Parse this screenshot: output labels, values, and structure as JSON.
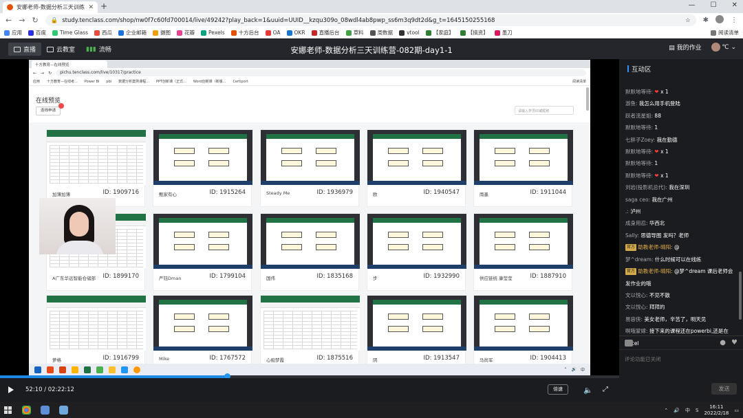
{
  "browser": {
    "tab_title": "安娜老师-数据分析三天训练营-0",
    "url": "study.tenclass.com/shop/nw0f7c60fd700014/live/49242?play_back=1&uuid=UUID__kzqu309o_08wdl4ab8pwp_ss6m3q9dt2d&g_t=1645150255168",
    "bookmarks": [
      "应用",
      "百度",
      "Time Glass",
      "西瓜",
      "企业邮箱",
      "摄图",
      "花瓣",
      "Pexels",
      "十方后台",
      "OA",
      "OKR",
      "直播后台",
      "草料",
      "周数据",
      "vtool",
      "【家庭】",
      "【搞资】",
      "墨刀"
    ],
    "reading_list": "阅读清单"
  },
  "header": {
    "tab_live": "直播",
    "tab_classroom": "云教室",
    "tab_traffic": "流畅",
    "title": "安娜老师-数据分析三天训练营-082期-day1-1",
    "homework": "我的作业",
    "user": "℃"
  },
  "inner": {
    "tab_title": "十方教育—在线预览",
    "url": "pichu.tenclass.com/live/10317/practice",
    "bookmarks": [
      "应用",
      "十方教育—在线考...",
      "Power BI",
      "pbi",
      "数据分析案例课程...",
      "PPT创新课（正式...",
      "Word创新课（新版...",
      "Certiport"
    ],
    "reading_list": "阅读清单",
    "panel_title": "在线预览",
    "panel_button": "连线申请",
    "search_placeholder": "请输入学员ID或昵称",
    "cards": [
      {
        "name": "加薄加薄",
        "id": "ID: 1909716"
      },
      {
        "name": "甄家有心",
        "id": "ID: 1915264"
      },
      {
        "name": "Steady Me",
        "id": "ID: 1936979"
      },
      {
        "name": "欧",
        "id": "ID: 1940547"
      },
      {
        "name": "雨墨",
        "id": "ID: 1911044"
      },
      {
        "name": "A广东华远智能仓储部",
        "id": "ID: 1899170"
      },
      {
        "name": "严钰Dman",
        "id": "ID: 1799104"
      },
      {
        "name": "国伟",
        "id": "ID: 1835168"
      },
      {
        "name": "步",
        "id": "ID: 1932990"
      },
      {
        "name": "供应链统 康莹莹",
        "id": "ID: 1887910"
      },
      {
        "name": "萝格",
        "id": "ID: 1916799"
      },
      {
        "name": "Mike",
        "id": "ID: 1767572"
      },
      {
        "name": "心痴梦霞",
        "id": "ID: 1875516"
      },
      {
        "name": "阴",
        "id": "ID: 1913547"
      },
      {
        "name": "马尚军",
        "id": "ID: 1904413"
      }
    ]
  },
  "chat": {
    "title": "互动区",
    "messages": [
      {
        "user": "默默地等待:",
        "text": "x 1",
        "heart": "❤",
        "teacher": false
      },
      {
        "user": "游鱼:",
        "text": "我怎么用手机登陆",
        "heart": "",
        "teacher": false
      },
      {
        "user": "跃者流星姐:",
        "text": "88",
        "heart": "",
        "teacher": false
      },
      {
        "user": "默默地等待:",
        "text": "1",
        "heart": "",
        "teacher": false
      },
      {
        "user": "七胖子Zoey:",
        "text": "我在勤德",
        "heart": "",
        "teacher": false
      },
      {
        "user": "默默地等待:",
        "text": "x 1",
        "heart": "❤",
        "teacher": false
      },
      {
        "user": "默默地等待:",
        "text": "1",
        "heart": "",
        "teacher": false
      },
      {
        "user": "默默地等待:",
        "text": "x 1",
        "heart": "❤",
        "teacher": false
      },
      {
        "user": "刘岩(投影机总代):",
        "text": "我在深圳",
        "heart": "",
        "teacher": false
      },
      {
        "user": "saga ceo:",
        "text": "我在广州",
        "heart": "",
        "teacher": false
      },
      {
        "user": ".:",
        "text": "泸州",
        "heart": "",
        "teacher": false
      },
      {
        "user": "成身用忍:",
        "text": "华西北",
        "heart": "",
        "teacher": false
      },
      {
        "user": "Sally:",
        "text": "思德导图 发吗？老师",
        "heart": "",
        "teacher": false
      },
      {
        "user": "助教老师-晴阳:",
        "text": "@",
        "heart": "",
        "teacher": true
      },
      {
        "user": "梦^dream:",
        "text": "什么时候可以在线练",
        "heart": "",
        "teacher": false
      },
      {
        "user": "助教老师-晴阳:",
        "text": "@梦^dream 课后老师会发作业的哦",
        "heart": "",
        "teacher": true
      },
      {
        "user": "文以悦心:",
        "text": "不见不散",
        "heart": "",
        "teacher": false
      },
      {
        "user": "文以悦心:",
        "text": "拜拜的",
        "heart": "",
        "teacher": false
      },
      {
        "user": "易容侠:",
        "text": "美女老师，辛苦了，明天见",
        "heart": "",
        "teacher": false
      },
      {
        "user": "啊哦蒙嫁:",
        "text": "接下来的课程还在powerbi,还是在excel",
        "heart": "",
        "teacher": false
      }
    ],
    "role_label": "官方",
    "input_placeholder": "评论功能已关闭",
    "send_label": "发送"
  },
  "player": {
    "time": "52:10 / 02:22:12",
    "progress": 0.367,
    "speed_label": "倍速"
  },
  "taskbar": {
    "clock_time": "16:11",
    "clock_date": "2022/2/18",
    "tray_lang": "中",
    "tray_s": "S"
  },
  "colors": {
    "accent": "#1e88e5",
    "excel_green": "#217346",
    "heart": "#ff3b3b",
    "role_badge": "#d4a94a"
  }
}
